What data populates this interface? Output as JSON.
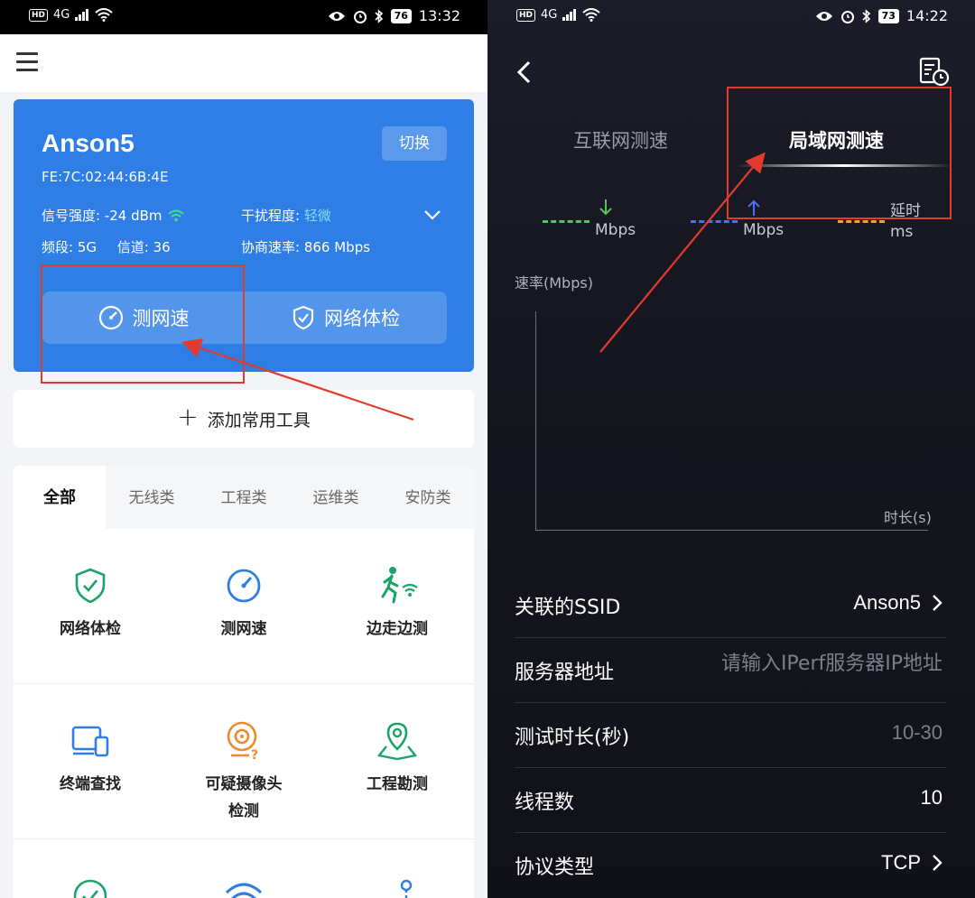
{
  "left": {
    "status": {
      "network": "4G",
      "battery": "76",
      "time": "13:32"
    },
    "card": {
      "ssid": "Anson5",
      "mac": "FE:7C:02:44:6B:4E",
      "switch_label": "切换",
      "signal_label": "信号强度:",
      "signal_value": "-24 dBm",
      "interference_label": "干扰程度:",
      "interference_value": "轻微",
      "band_label": "频段:",
      "band_value": "5G",
      "channel_label": "信道:",
      "channel_value": "36",
      "rate_label": "协商速率:",
      "rate_value": "866 Mbps",
      "speed_test": "测网速",
      "network_check": "网络体检"
    },
    "add_tools": "添加常用工具",
    "tabs": [
      "全部",
      "无线类",
      "工程类",
      "运维类",
      "安防类"
    ],
    "tools_row1": [
      "网络体检",
      "测网速",
      "边走边测"
    ],
    "tools_row2": [
      "终端查找",
      "可疑摄像头",
      "工程勘测"
    ],
    "tools_row2_sub": "检测",
    "colors": {
      "card": "#2e7ee6",
      "accent_green": "#1aa36a",
      "accent_blue": "#2f7fe0",
      "accent_orange": "#e98b2e"
    }
  },
  "right": {
    "status": {
      "network": "4G",
      "battery": "73",
      "time": "14:22"
    },
    "tab_internet": "互联网测速",
    "tab_lan": "局域网测速",
    "legend": {
      "down_unit": "Mbps",
      "up_unit": "Mbps",
      "latency_label": "延时",
      "latency_unit": "ms",
      "down_color": "#58c35b",
      "up_color": "#4f6fe8",
      "latency_color": "#e8a43a"
    },
    "chart": {
      "ylabel": "速率(Mbps)",
      "xlabel": "时长(s)"
    },
    "form": {
      "ssid_label": "关联的SSID",
      "ssid_value": "Anson5",
      "server_label": "服务器地址",
      "server_placeholder": "请输入IPerf服务器IP地址",
      "duration_label": "测试时长(秒)",
      "duration_value": "10-30",
      "threads_label": "线程数",
      "threads_value": "10",
      "protocol_label": "协议类型",
      "protocol_value": "TCP"
    }
  }
}
